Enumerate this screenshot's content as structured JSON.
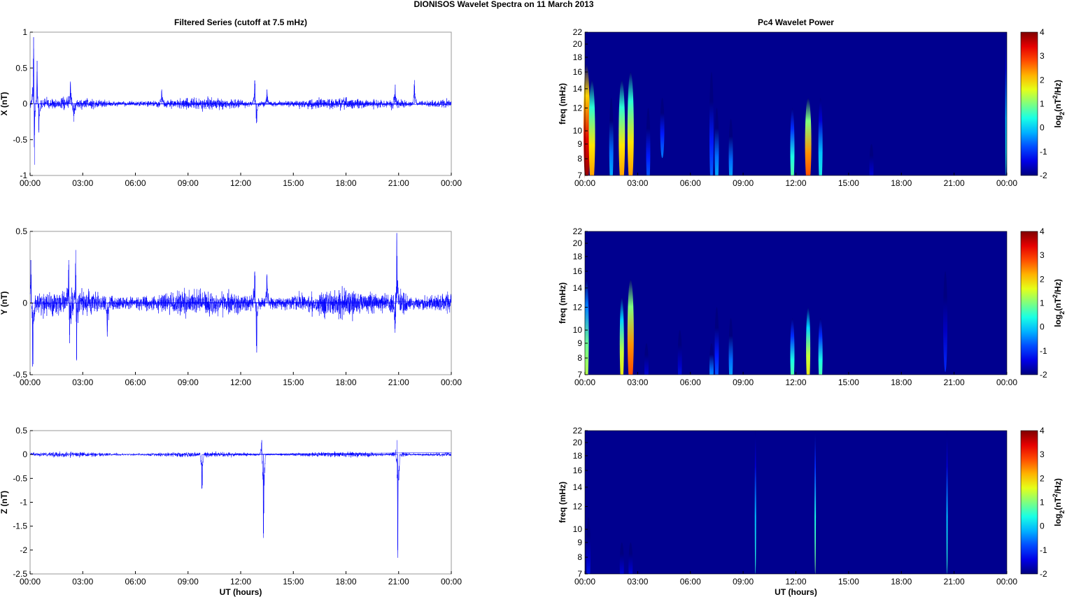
{
  "title": "DIONISOS Wavelet Spectra on 11 March     2013",
  "chart_data": [
    {
      "type": "line",
      "name": "X",
      "title": "Filtered Series (cutoff at 7.5 mHz)",
      "ylabel": "X (nT)",
      "xlabel": "",
      "ylim": [
        -1,
        1
      ],
      "yticks": [
        {
          "v": 1,
          "l": "1"
        },
        {
          "v": 0.5,
          "l": "0.5"
        },
        {
          "v": 0,
          "l": "0"
        },
        {
          "v": -0.5,
          "l": "-0.5"
        },
        {
          "v": -1,
          "l": "-1"
        }
      ],
      "noise": 0.05,
      "spikes": [
        [
          0.2,
          0.93
        ],
        [
          0.25,
          -0.85
        ],
        [
          0.4,
          0.6
        ],
        [
          0.5,
          -0.4
        ],
        [
          2.3,
          0.3
        ],
        [
          2.5,
          -0.25
        ],
        [
          12.8,
          0.32
        ],
        [
          12.9,
          -0.27
        ],
        [
          21.9,
          0.33
        ],
        [
          7.5,
          0.2
        ],
        [
          13.5,
          0.2
        ],
        [
          20.8,
          0.22
        ]
      ]
    },
    {
      "type": "line",
      "name": "Y",
      "title": "",
      "ylabel": "Y (nT)",
      "xlabel": "",
      "ylim": [
        -0.5,
        0.5
      ],
      "yticks": [
        {
          "v": 0.5,
          "l": "0.5"
        },
        {
          "v": 0,
          "l": "0"
        },
        {
          "v": -0.5,
          "l": "-0.5"
        }
      ],
      "noise": 0.06,
      "spikes": [
        [
          0.05,
          0.3
        ],
        [
          0.15,
          -0.4
        ],
        [
          2.2,
          0.3
        ],
        [
          2.25,
          -0.28
        ],
        [
          2.6,
          0.37
        ],
        [
          2.65,
          -0.4
        ],
        [
          12.8,
          0.22
        ],
        [
          12.9,
          -0.3
        ],
        [
          13.5,
          0.2
        ],
        [
          20.9,
          0.44
        ],
        [
          20.8,
          -0.2
        ],
        [
          4.4,
          -0.2
        ]
      ]
    },
    {
      "type": "line",
      "name": "Z",
      "title": "",
      "ylabel": "Z (nT)",
      "xlabel": "UT (hours)",
      "ylim": [
        -2.5,
        0.5
      ],
      "yticks": [
        {
          "v": 0.5,
          "l": "0.5"
        },
        {
          "v": 0,
          "l": "0"
        },
        {
          "v": -0.5,
          "l": "-0.5"
        },
        {
          "v": -1,
          "l": "-1"
        },
        {
          "v": -1.5,
          "l": "-1.5"
        },
        {
          "v": -2,
          "l": "-2"
        },
        {
          "v": -2.5,
          "l": "-2.5"
        }
      ],
      "noise": 0.035,
      "spikes": [
        [
          9.8,
          -0.7
        ],
        [
          13.3,
          -1.65
        ],
        [
          20.95,
          -2.0
        ],
        [
          20.9,
          0.3
        ],
        [
          13.2,
          0.3
        ]
      ]
    },
    {
      "type": "heatmap",
      "name": "X",
      "title": "Pc4 Wavelet Power",
      "ylabel": "freq (mHz)",
      "xlabel": "",
      "ylim": [
        7,
        22
      ],
      "yticks": [
        "7",
        "8",
        "9",
        "10",
        "12",
        "14",
        "16",
        "18",
        "20",
        "22"
      ],
      "clim": [
        -2,
        4
      ],
      "colorbar_label": "log2(nT2/Hz)",
      "bursts": [
        [
          0.1,
          7,
          17,
          4
        ],
        [
          0.4,
          7,
          15,
          2.5
        ],
        [
          1.5,
          7,
          13,
          0
        ],
        [
          2.1,
          7,
          15,
          2.5
        ],
        [
          2.6,
          7,
          16,
          2.5
        ],
        [
          3.6,
          7,
          12,
          -0.5
        ],
        [
          4.4,
          9,
          13,
          -0.5
        ],
        [
          7.2,
          7,
          16,
          -0.5
        ],
        [
          7.5,
          7,
          12,
          0
        ],
        [
          8.3,
          7,
          11,
          0
        ],
        [
          11.8,
          7,
          12,
          1
        ],
        [
          12.7,
          7,
          13,
          3
        ],
        [
          13.4,
          7,
          13,
          0.5
        ],
        [
          16.3,
          7,
          9,
          -1
        ],
        [
          23.95,
          7,
          22,
          0.5
        ]
      ]
    },
    {
      "type": "heatmap",
      "name": "Y",
      "title": "",
      "ylabel": "freq (mHz)",
      "xlabel": "",
      "ylim": [
        7,
        22
      ],
      "yticks": [
        "7",
        "8",
        "9",
        "10",
        "12",
        "14",
        "16",
        "18",
        "20",
        "22"
      ],
      "clim": [
        -2,
        4
      ],
      "colorbar_label": "log2(nT2/Hz)",
      "bursts": [
        [
          0.1,
          7,
          15,
          1.5
        ],
        [
          2.1,
          7,
          13,
          2
        ],
        [
          2.6,
          7,
          15,
          3
        ],
        [
          3.5,
          7,
          9,
          -1
        ],
        [
          5.4,
          7,
          10,
          -1
        ],
        [
          7.2,
          7,
          9,
          0
        ],
        [
          7.5,
          7,
          12,
          -0.5
        ],
        [
          8.3,
          7,
          11,
          0
        ],
        [
          11.8,
          7,
          11,
          1
        ],
        [
          12.7,
          7,
          12,
          2
        ],
        [
          13.4,
          7,
          11,
          1
        ],
        [
          20.5,
          8,
          16,
          -1
        ]
      ]
    },
    {
      "type": "heatmap",
      "name": "Z",
      "title": "",
      "ylabel": "freq (mHz)",
      "xlabel": "UT (hours)",
      "ylim": [
        7,
        22
      ],
      "yticks": [
        "7",
        "8",
        "9",
        "10",
        "12",
        "14",
        "16",
        "18",
        "20",
        "22"
      ],
      "clim": [
        -2,
        4
      ],
      "colorbar_label": "log2(nT2/Hz)",
      "bursts": [
        [
          0.2,
          7,
          11,
          -1
        ],
        [
          2.1,
          7,
          9,
          -1
        ],
        [
          2.6,
          7,
          9,
          -1
        ],
        [
          9.7,
          7,
          22,
          0.5
        ],
        [
          13.1,
          7,
          22,
          1
        ],
        [
          20.6,
          7,
          22,
          0.5
        ]
      ]
    }
  ],
  "xticks": [
    "00:00",
    "03:00",
    "06:00",
    "09:00",
    "12:00",
    "15:00",
    "18:00",
    "21:00",
    "00:00"
  ],
  "colorbar_ticks": [
    "4",
    "3",
    "2",
    "1",
    "0",
    "-1",
    "-2"
  ],
  "colors": {
    "line": "#0000ff",
    "background": "#00008f"
  }
}
